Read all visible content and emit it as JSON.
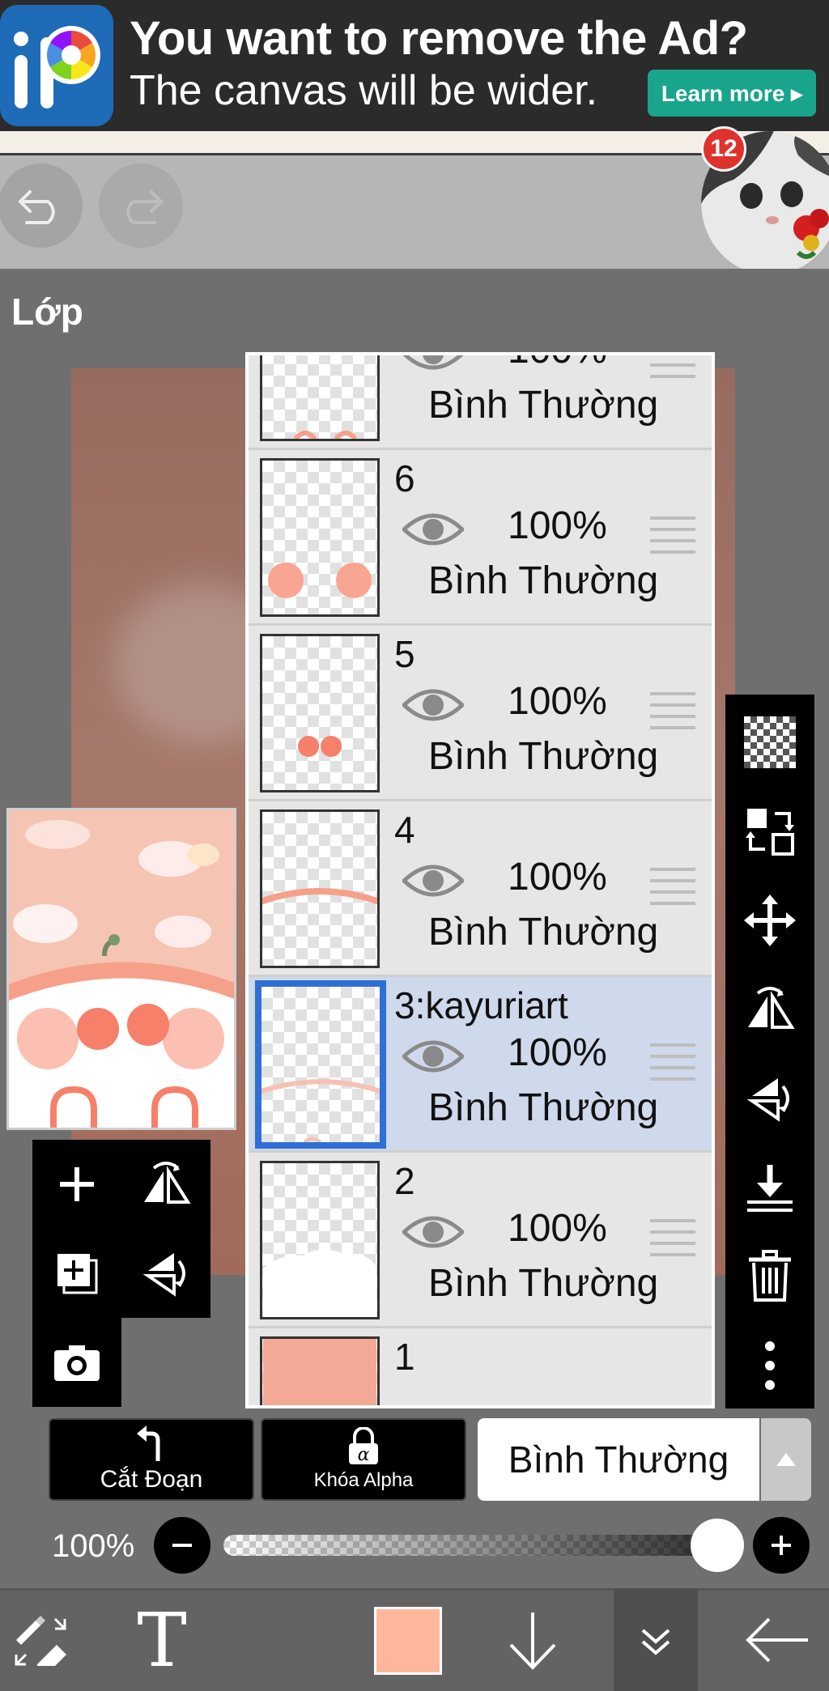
{
  "ad": {
    "title": "You want to remove the Ad?",
    "subtitle": "The canvas will be wider.",
    "button_label": "Learn more ▸"
  },
  "topbar": {
    "notification_count": "12"
  },
  "panel": {
    "title": "Lớp"
  },
  "layers": [
    {
      "name": "",
      "opacity": "100%",
      "blend": "Bình Thường",
      "selected": false
    },
    {
      "name": "6",
      "opacity": "100%",
      "blend": "Bình Thường",
      "selected": false
    },
    {
      "name": "5",
      "opacity": "100%",
      "blend": "Bình Thường",
      "selected": false
    },
    {
      "name": "4",
      "opacity": "100%",
      "blend": "Bình Thường",
      "selected": false
    },
    {
      "name": "3:kayuriart",
      "opacity": "100%",
      "blend": "Bình Thường",
      "selected": true
    },
    {
      "name": "2",
      "opacity": "100%",
      "blend": "Bình Thường",
      "selected": false
    },
    {
      "name": "1",
      "opacity": "",
      "blend": "",
      "selected": false
    }
  ],
  "controls": {
    "clip_label": "Cắt Đoạn",
    "alpha_lock_label": "Khóa Alpha",
    "blend_mode": "Bình Thường",
    "opacity_label": "100%",
    "opacity_value": 1.0
  },
  "colors": {
    "current_color": "#ffb79c",
    "selection_border": "#2f6fd6",
    "ad_button": "#19a48c",
    "badge": "#e0322d"
  },
  "icons": {
    "undo": "undo-icon",
    "redo": "redo-icon",
    "add_layer": "plus-icon",
    "flip_h": "flip-horizontal-icon",
    "duplicate": "duplicate-layer-icon",
    "flip_v": "flip-vertical-icon",
    "camera": "camera-icon",
    "transparency": "checkerboard-icon",
    "swap": "swap-layers-icon",
    "move": "move-icon",
    "merge_down": "merge-down-icon",
    "delete": "trash-icon",
    "more": "more-vertical-icon"
  }
}
